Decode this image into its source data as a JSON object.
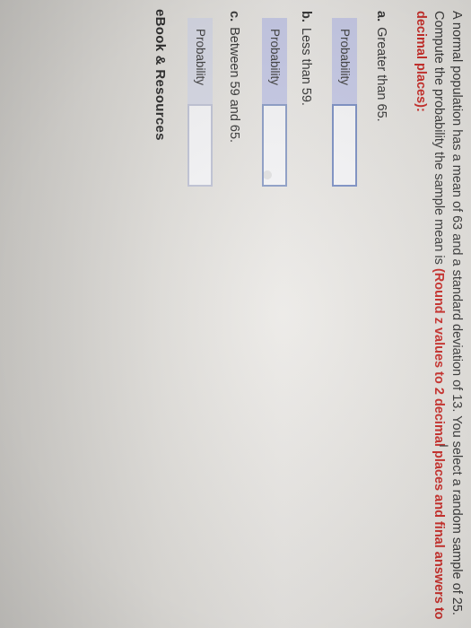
{
  "question": {
    "line1": "A normal population has a mean of 63 and a standard deviation of 13. You select a random sample of 25.",
    "line2_prefix": "Compute the probability the sample mean is ",
    "line2_red": "(Round z values to 2 decimal places and final answers to",
    "line3_red": "decimal places):"
  },
  "parts": {
    "a": {
      "letter": "a.",
      "text": "Greater than 65.",
      "label": "Probability",
      "value": ""
    },
    "b": {
      "letter": "b.",
      "text": "Less than 59.",
      "label": "Probability",
      "value": ""
    },
    "c": {
      "letter": "c.",
      "text": "Between 59 and 65.",
      "label": "Probability",
      "value": ""
    }
  },
  "footer": {
    "resources": "eBook & Resources"
  },
  "colors": {
    "instruction_red": "#c9302c",
    "label_bg": "#c9cce8",
    "input_border": "#7f93c6"
  }
}
